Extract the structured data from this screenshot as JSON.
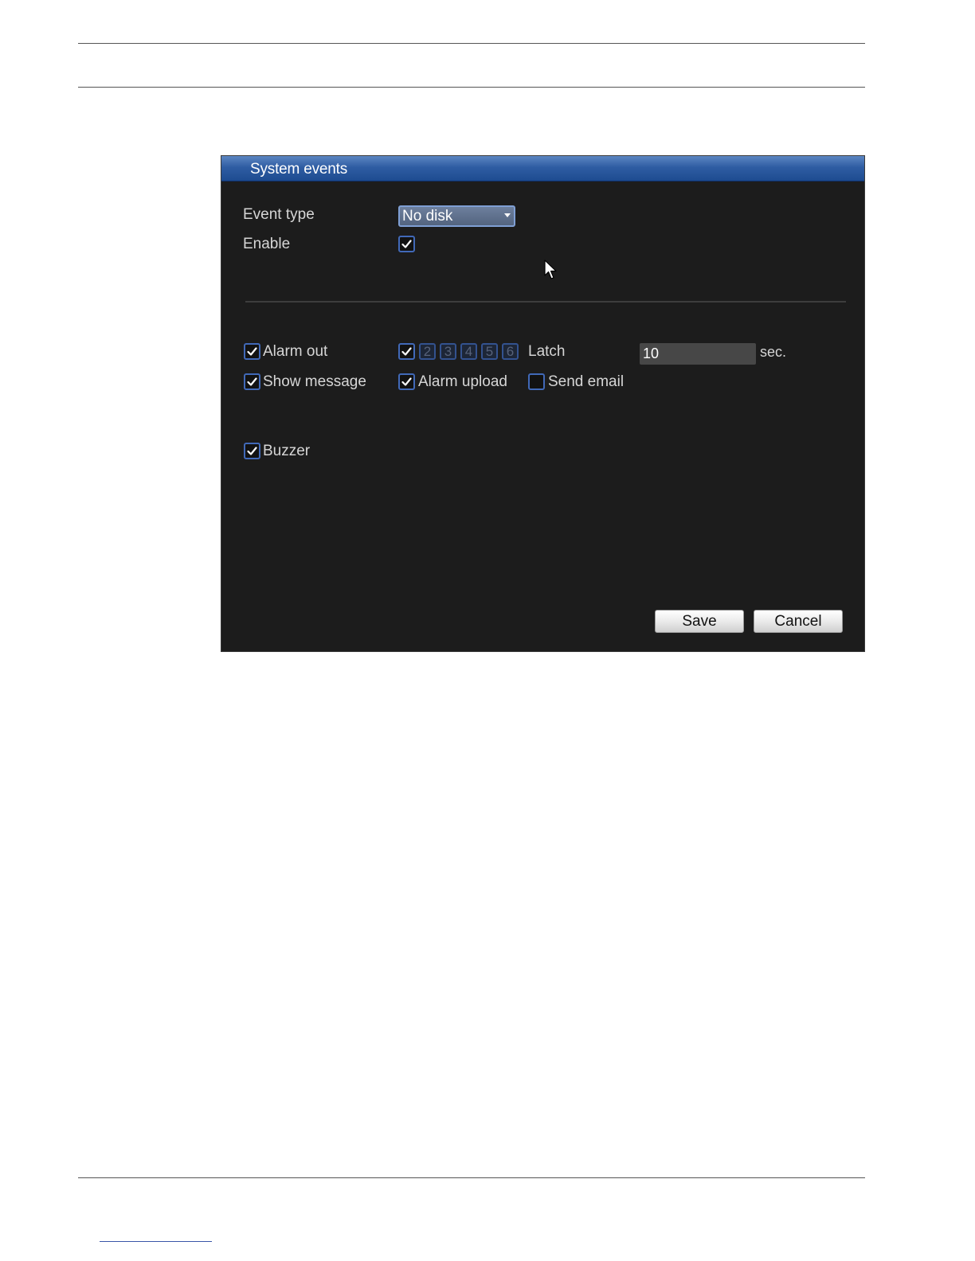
{
  "dialog": {
    "title": "System events",
    "event_type": {
      "label": "Event type",
      "selected": "No disk"
    },
    "enable": {
      "label": "Enable",
      "checked": true
    },
    "alarm_out": {
      "label": "Alarm out",
      "checked": true,
      "channel_all_checked": true,
      "channels": [
        "2",
        "3",
        "4",
        "5",
        "6"
      ],
      "latch_label": "Latch",
      "latch_value": "10",
      "latch_unit": "sec."
    },
    "show_message": {
      "label": "Show message",
      "checked": true
    },
    "alarm_upload": {
      "label": "Alarm upload",
      "checked": true
    },
    "send_email": {
      "label": "Send email",
      "checked": false
    },
    "buzzer": {
      "label": "Buzzer",
      "checked": true
    },
    "buttons": {
      "save": "Save",
      "cancel": "Cancel"
    }
  },
  "icons": {
    "check": "check-icon",
    "dropdown": "chevron-down-icon",
    "pointer": "mouse-pointer-icon"
  },
  "colors": {
    "titlebar": "#2f5da3",
    "dialog_bg": "#1c1c1c",
    "checkbox_border": "#4169b8"
  }
}
